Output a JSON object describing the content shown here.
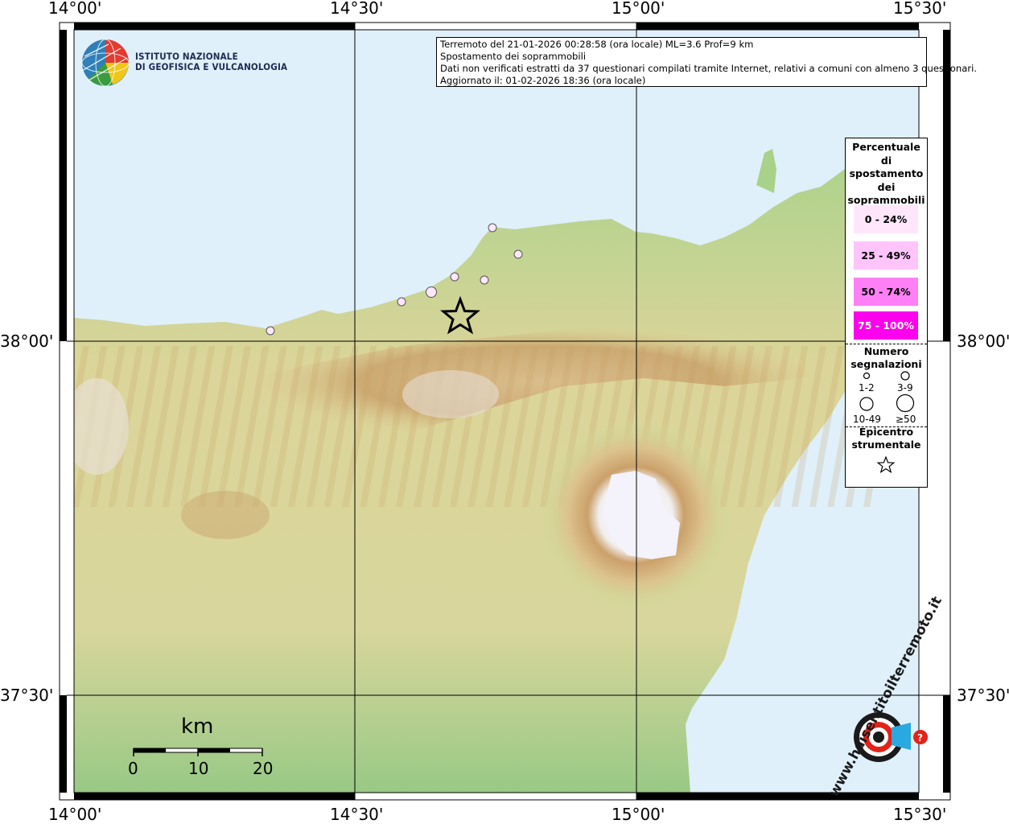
{
  "map": {
    "axis_labels": {
      "lon": [
        "14°00'",
        "14°30'",
        "15°00'",
        "15°30'"
      ],
      "lat": [
        "38°00'",
        "37°30'"
      ]
    },
    "colors": {
      "sea": "#dff0fb",
      "lowland": "#9fcf87",
      "hills": "#e1d69e",
      "mountain": "#c69a5c",
      "summit": "#f5f3fa",
      "grid": "#000000"
    }
  },
  "institute": {
    "name_line1": "ISTITUTO NAZIONALE",
    "name_line2": "DI GEOFISICA E VULCANOLOGIA"
  },
  "info": {
    "line1": "Terremoto del 21-01-2026 00:28:58 (ora locale) ML=3.6 Prof=9 km",
    "line2": "Spostamento dei soprammobili",
    "line3": "Dati non verificati estratti da 37 questionari compilati tramite Internet, relativi a comuni con almeno 3 questionari.",
    "line4": "Aggiornato il: 01-02-2026 18:36 (ora locale)"
  },
  "legend": {
    "percent_title": [
      "Percentuale",
      "di",
      "spostamento",
      "dei",
      "soprammobili"
    ],
    "bins": [
      {
        "label": "0 - 24%",
        "color": "#ffe6fb"
      },
      {
        "label": "25 - 49%",
        "color": "#ffc5fb"
      },
      {
        "label": "50 - 74%",
        "color": "#ff80f6"
      },
      {
        "label": "75 - 100%",
        "color": "#ff00ee"
      }
    ],
    "count_title": [
      "Numero",
      "segnalazioni"
    ],
    "count_bins": [
      "1-2",
      "3-9",
      "10-49",
      "≥50"
    ],
    "epicenter_title": [
      "Epicentro",
      "strumentale"
    ]
  },
  "scale": {
    "unit": "km",
    "ticks": [
      "0",
      "10",
      "20"
    ]
  },
  "watermark": {
    "brand": "haisentitoilterremoto.it",
    "prefix": "www."
  },
  "observations": [
    {
      "name": "pt1",
      "bin": 0
    },
    {
      "name": "pt2",
      "bin": 0
    },
    {
      "name": "pt3",
      "bin": 0
    },
    {
      "name": "pt4",
      "bin": 0
    },
    {
      "name": "pt5",
      "bin": 0
    },
    {
      "name": "pt6",
      "bin": 0
    },
    {
      "name": "pt7",
      "bin": 0
    }
  ]
}
